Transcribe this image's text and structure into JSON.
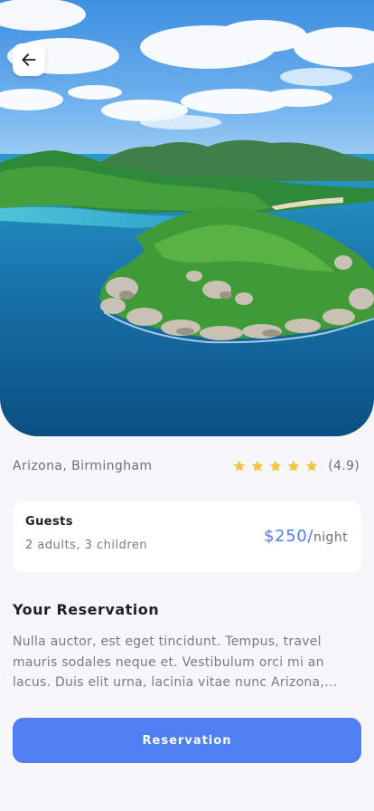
{
  "hero": {
    "image_name": "tropical-island-aerial-photo",
    "back_icon": "arrow-left-icon"
  },
  "location": "Arizona, Birmingham",
  "rating": {
    "stars": 5,
    "star_icon": "star-icon",
    "star_color": "#f5c342",
    "value_text": "(4.9)"
  },
  "guests": {
    "title": "Guests",
    "detail": "2 adults, 3 children",
    "price": "$250/",
    "price_unit": "night"
  },
  "reservation": {
    "title": "Your Reservation",
    "description": "Nulla auctor, est eget tincidunt. Tempus, travel mauris sodales neque et. Vestibulum orci mi an lacus. Duis elit urna, lacinia vitae nunc Arizona, Birmingham lorem ipsum dolor sit amet.",
    "button_label": "Reservation"
  },
  "colors": {
    "accent": "#4f7ff2",
    "background": "#f7f7f9",
    "card": "#ffffff"
  }
}
